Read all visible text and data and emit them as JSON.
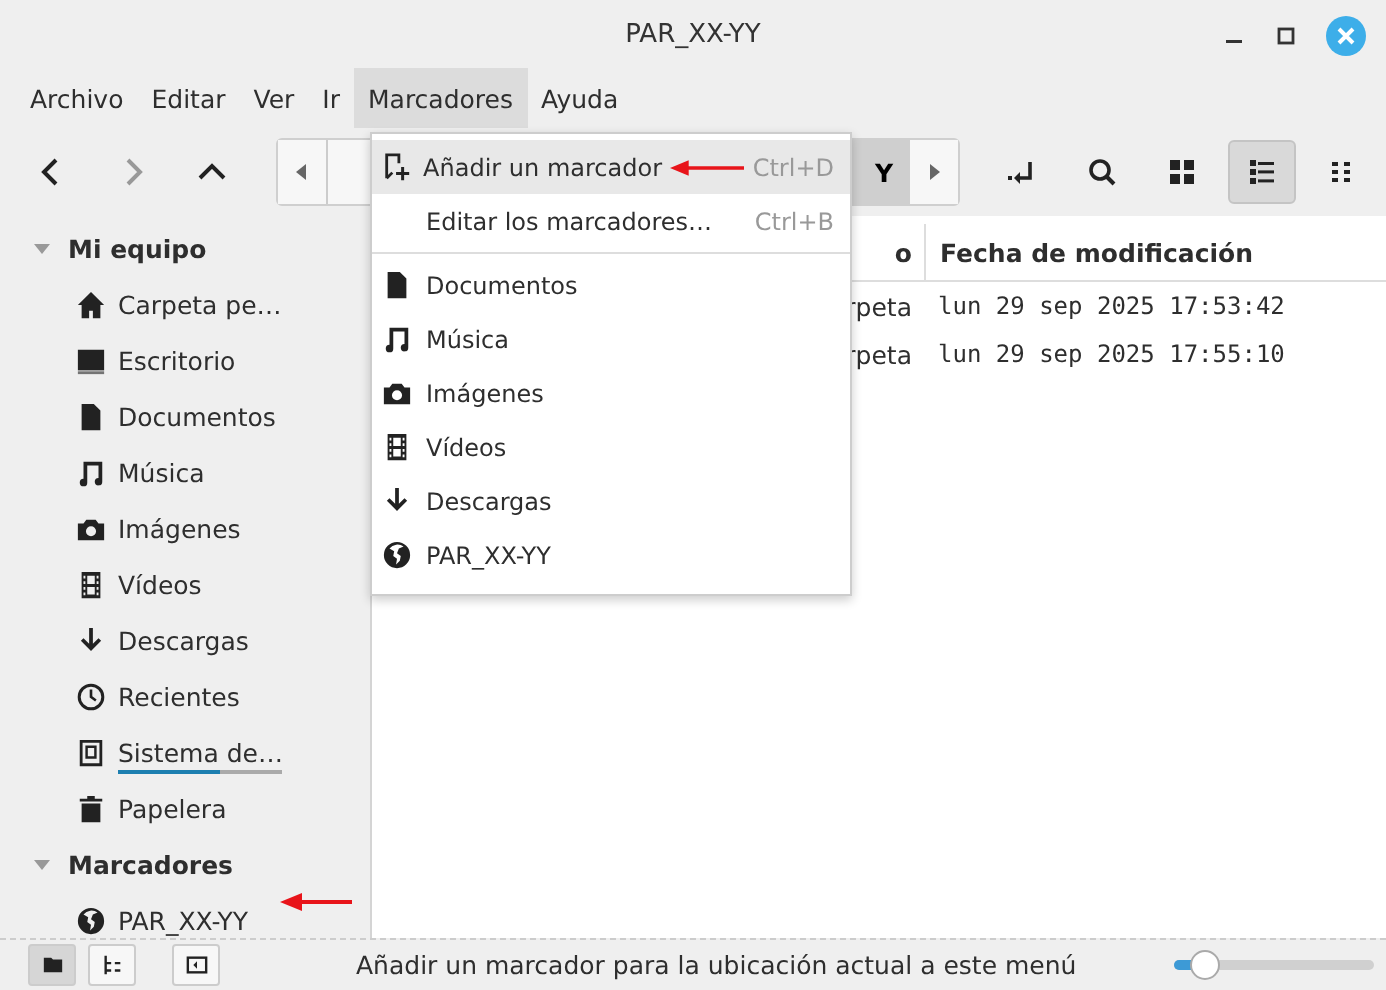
{
  "window": {
    "title": "PAR_XX-YY"
  },
  "menubar": [
    {
      "label": "Archivo",
      "selected": false
    },
    {
      "label": "Editar",
      "selected": false
    },
    {
      "label": "Ver",
      "selected": false
    },
    {
      "label": "Ir",
      "selected": false
    },
    {
      "label": "Marcadores",
      "selected": true
    },
    {
      "label": "Ayuda",
      "selected": false
    }
  ],
  "pathbar": {
    "current": "Y"
  },
  "view_buttons": [
    {
      "selected": false
    },
    {
      "selected": false
    },
    {
      "selected": false
    },
    {
      "selected": true
    },
    {
      "selected": false
    }
  ],
  "sidebar": {
    "sections": [
      {
        "title": "Mi equipo",
        "expanded": true,
        "items": [
          {
            "label": "Carpeta pe…"
          },
          {
            "label": "Escritorio"
          },
          {
            "label": "Documentos"
          },
          {
            "label": "Música"
          },
          {
            "label": "Imágenes"
          },
          {
            "label": "Vídeos"
          },
          {
            "label": "Descargas"
          },
          {
            "label": "Recientes"
          },
          {
            "label": "Sistema de…",
            "level": 0.62
          },
          {
            "label": "Papelera"
          }
        ]
      },
      {
        "title": "Marcadores",
        "expanded": true,
        "items": [
          {
            "label": "PAR_XX-YY"
          }
        ]
      }
    ]
  },
  "table": {
    "columns": [
      "o",
      "Fecha de modificación"
    ],
    "rows": [
      [
        "rpeta",
        "lun 29 sep 2025 17:53:42"
      ],
      [
        "rpeta",
        "lun 29 sep 2025 17:55:10"
      ]
    ]
  },
  "menu": {
    "actions": [
      {
        "label": "Añadir un marcador",
        "shortcut": "Ctrl+D",
        "selected": true
      },
      {
        "label": "Editar los marcadores…",
        "shortcut": "Ctrl+B",
        "selected": false
      }
    ],
    "bookmarks": [
      {
        "label": "Documentos"
      },
      {
        "label": "Música"
      },
      {
        "label": "Imágenes"
      },
      {
        "label": "Vídeos"
      },
      {
        "label": "Descargas"
      },
      {
        "label": "PAR_XX-YY"
      }
    ]
  },
  "status_bar": {
    "text": "Añadir un marcador para la ubicación actual a este menú",
    "zoom": {
      "level": 0.15
    },
    "panes": [
      {
        "selected": true
      },
      {
        "selected": false
      }
    ]
  }
}
